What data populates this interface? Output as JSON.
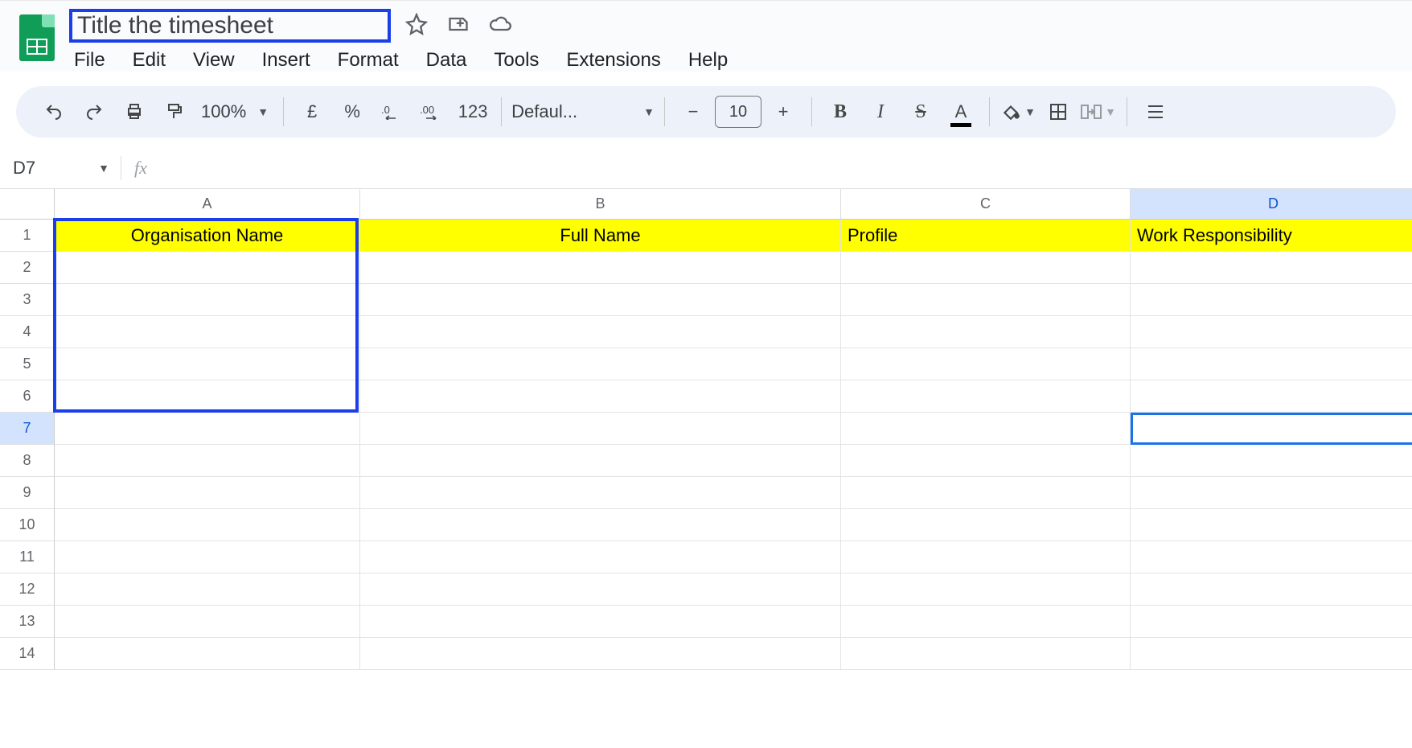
{
  "doc": {
    "title": "Title the timesheet"
  },
  "menu": {
    "file": "File",
    "edit": "Edit",
    "view": "View",
    "insert": "Insert",
    "format": "Format",
    "data": "Data",
    "tools": "Tools",
    "extensions": "Extensions",
    "help": "Help"
  },
  "toolbar": {
    "zoom": "100%",
    "currency": "£",
    "percent": "%",
    "number_format": "123",
    "font_name": "Defaul...",
    "font_size": "10"
  },
  "formula_bar": {
    "name_box": "D7",
    "fx": "fx"
  },
  "columns": {
    "A": "A",
    "B": "B",
    "C": "C",
    "D": "D"
  },
  "rows": {
    "1": "1",
    "2": "2",
    "3": "3",
    "4": "4",
    "5": "5",
    "6": "6",
    "7": "7",
    "8": "8",
    "9": "9",
    "10": "10",
    "11": "11",
    "12": "12",
    "13": "13",
    "14": "14"
  },
  "sheet": {
    "headers": {
      "A1": "Organisation Name",
      "B1": "Full Name",
      "C1": "Profile",
      "D1": "Work Responsibility"
    }
  },
  "selection": {
    "active_cell": "D7"
  }
}
